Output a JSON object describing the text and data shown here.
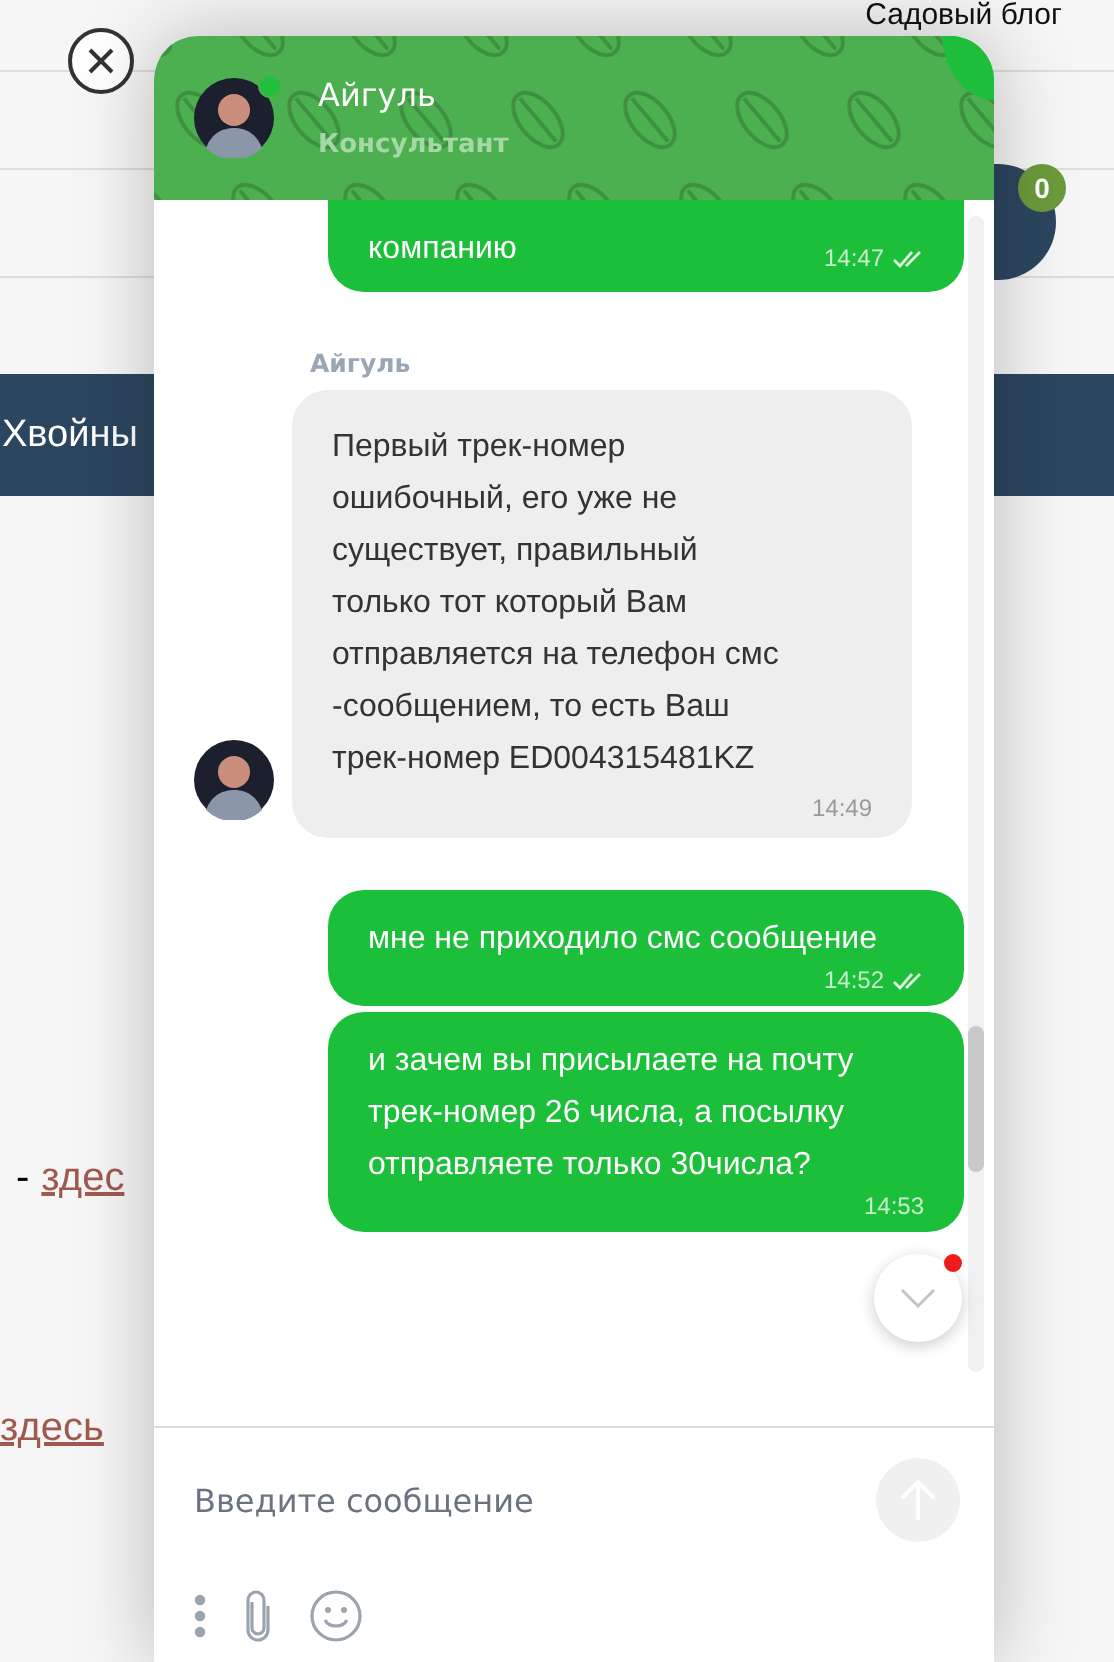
{
  "page": {
    "blog_link": "Садовый блог",
    "cart_count": "0",
    "category": "Хвойны",
    "link_1_prefix": "-",
    "link_1": "здес",
    "link_2": "здесь"
  },
  "chat": {
    "agent": {
      "name": "Айгуль",
      "role": "Консультант",
      "online": true
    },
    "messages": [
      {
        "kind": "outgoing",
        "text": "компанию",
        "time": "14:47",
        "read": true
      },
      {
        "kind": "incoming",
        "sender": "Айгуль",
        "text": "Первый трек-номер ошибочный, его уже не существует, правильный только тот который Вам отправляется на телефон смс -сообщением, то есть Ваш трек-номер ED004315481KZ",
        "time": "14:49"
      },
      {
        "kind": "outgoing",
        "text": "мне не приходило смс сообщение",
        "time": "14:52",
        "read": true
      },
      {
        "kind": "outgoing",
        "text": "и зачем вы присылаете на почту трек-номер 26 числа, а посылку отправляете только 30числа?",
        "time": "14:53"
      }
    ],
    "scroll_down": {
      "unread": true
    },
    "composer": {
      "placeholder": "Введите сообщение"
    }
  }
}
